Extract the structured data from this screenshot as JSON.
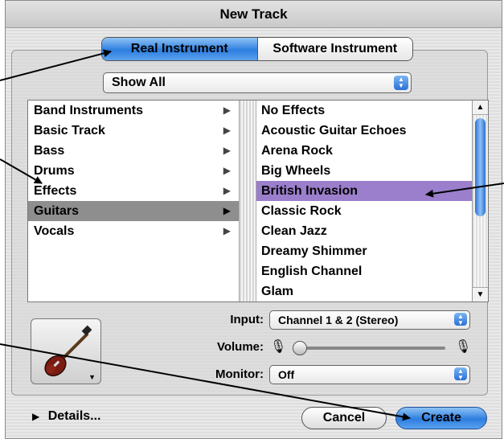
{
  "window": {
    "title": "New Track"
  },
  "tabs": [
    {
      "label": "Real Instrument",
      "selected": true
    },
    {
      "label": "Software Instrument",
      "selected": false
    }
  ],
  "filter": {
    "value": "Show All"
  },
  "categories": [
    {
      "label": "Band Instruments"
    },
    {
      "label": "Basic Track"
    },
    {
      "label": "Bass"
    },
    {
      "label": "Drums"
    },
    {
      "label": "Effects"
    },
    {
      "label": "Guitars",
      "selected": true
    },
    {
      "label": "Vocals"
    }
  ],
  "presets": [
    {
      "label": "No Effects"
    },
    {
      "label": "Acoustic Guitar Echoes"
    },
    {
      "label": "Arena Rock"
    },
    {
      "label": "Big Wheels"
    },
    {
      "label": "British Invasion",
      "selected": true
    },
    {
      "label": "Classic Rock"
    },
    {
      "label": "Clean Jazz"
    },
    {
      "label": "Dreamy Shimmer"
    },
    {
      "label": "English Channel"
    },
    {
      "label": "Glam"
    }
  ],
  "settings": {
    "input_label": "Input:",
    "input_value": "Channel 1 & 2 (Stereo)",
    "volume_label": "Volume:",
    "volume_level": 0.0,
    "monitor_label": "Monitor:",
    "monitor_value": "Off"
  },
  "footer": {
    "details_label": "Details...",
    "cancel_label": "Cancel",
    "create_label": "Create"
  },
  "colors": {
    "accent_blue": "#2d7ee0",
    "preset_selection": "#9b7fcc",
    "category_selection": "#8e8e8e"
  },
  "icons": {
    "track_icon": "electric-guitar-icon",
    "disclosure": "disclosure-triangle-icon",
    "volume_low": "microphone-low-icon",
    "volume_high": "microphone-high-icon"
  }
}
